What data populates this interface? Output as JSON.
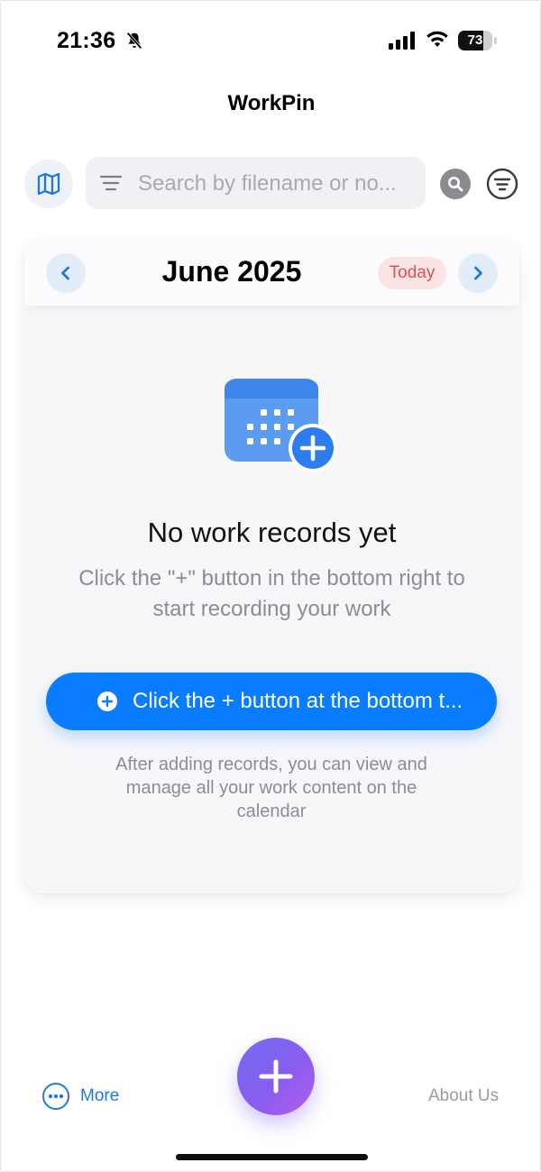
{
  "status_bar": {
    "time": "21:36",
    "battery_percent": "73",
    "icons": [
      "bell-slash-icon",
      "signal-icon",
      "wifi-icon",
      "battery-icon"
    ]
  },
  "header": {
    "title": "WorkPin"
  },
  "search": {
    "placeholder": "Search by filename or no...",
    "icons": [
      "map-icon",
      "menu-icon",
      "search-icon",
      "filter-icon"
    ]
  },
  "calendar": {
    "month_label": "June 2025",
    "today_label": "Today",
    "icons": [
      "chevron-left-icon",
      "chevron-right-icon"
    ]
  },
  "empty_state": {
    "icon": "calendar-plus-icon",
    "title": "No work records yet",
    "description": "Click the \"+\" button in the bottom right to start recording your work",
    "cta_label": "Click the + button at the bottom t...",
    "footnote": "After adding records, you can view and manage all your work content on the calendar"
  },
  "bottom_bar": {
    "more_label": "More",
    "about_label": "About Us",
    "fab_icon": "plus-icon"
  },
  "colors": {
    "accent": "#0a7cff",
    "today_bg": "#fbe4e4",
    "today_text": "#d9534f",
    "fab_gradient_start": "#6f6cf2",
    "fab_gradient_end": "#b45ee8",
    "link": "#1f7ae0"
  }
}
